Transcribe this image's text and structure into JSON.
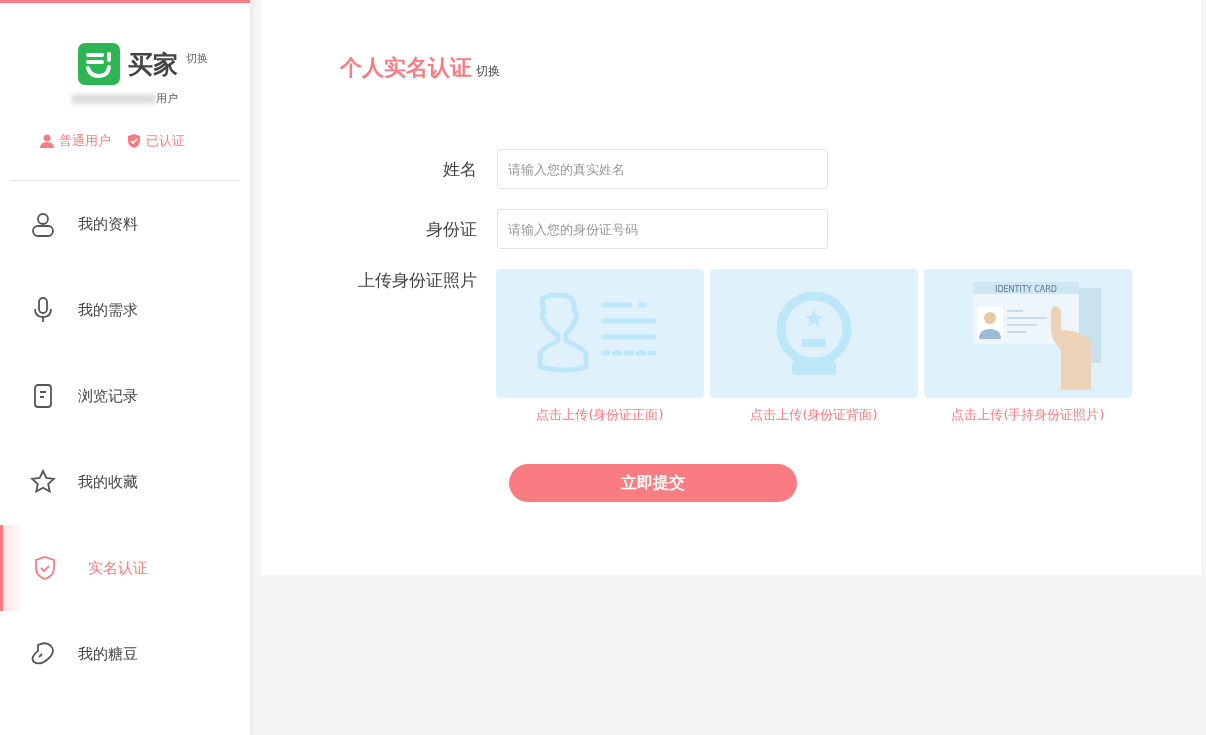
{
  "brand": {
    "name": "买家",
    "switch": "切换",
    "user_suffix": "用户"
  },
  "badges": [
    {
      "kind": "user",
      "label": "普通用户"
    },
    {
      "kind": "verified",
      "label": "已认证"
    }
  ],
  "menu": [
    {
      "kind": "person",
      "label": "我的资料",
      "selected": false
    },
    {
      "kind": "mic",
      "label": "我的需求",
      "selected": false
    },
    {
      "kind": "doc",
      "label": "浏览记录",
      "selected": false
    },
    {
      "kind": "star",
      "label": "我的收藏",
      "selected": false
    },
    {
      "kind": "shield",
      "label": "实名认证",
      "selected": true
    },
    {
      "kind": "bean",
      "label": "我的糖豆",
      "selected": false
    }
  ],
  "page": {
    "title": "个人实名认证",
    "switch": "切换"
  },
  "fields": [
    {
      "label": "姓名",
      "placeholder": "请输入您的真实姓名"
    },
    {
      "label": "身份证",
      "placeholder": "请输入您的身份证号码"
    }
  ],
  "upload": {
    "label": "上传身份证照片",
    "cards": [
      {
        "kind": "front",
        "caption": "点击上传(身份证正面)"
      },
      {
        "kind": "back",
        "caption": "点击上传(身份证背面)"
      },
      {
        "kind": "hand",
        "caption": "点击上传(手持身份证照片)",
        "card_text": "IDENTITY CARD"
      }
    ]
  },
  "submit": "立即提交"
}
